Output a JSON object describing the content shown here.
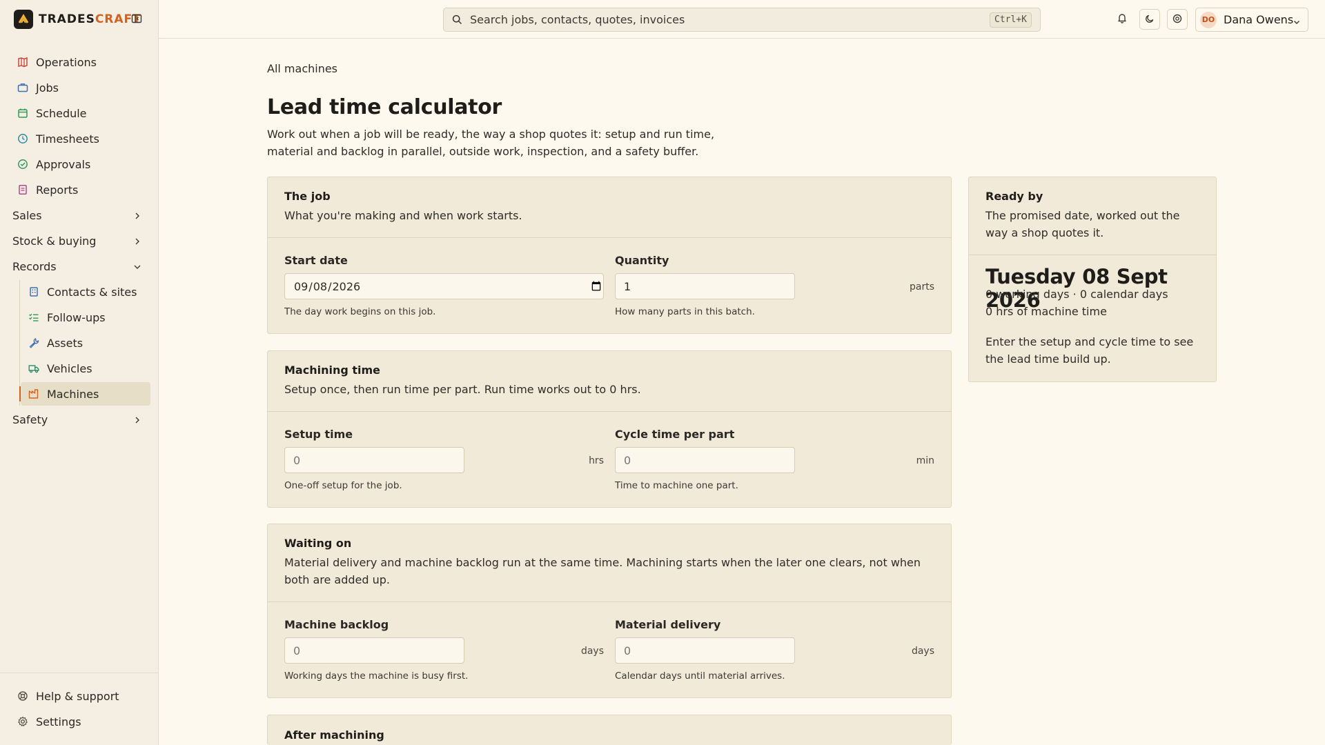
{
  "brand": {
    "name_a": "TRADES",
    "name_b": "CRAFT",
    "accent": "#d2621f"
  },
  "sidebar": {
    "items": [
      {
        "label": "Operations",
        "icon": "map-icon",
        "color": "#c9463d"
      },
      {
        "label": "Jobs",
        "icon": "briefcase-icon",
        "color": "#3f6fb5"
      },
      {
        "label": "Schedule",
        "icon": "calendar-icon",
        "color": "#2f9a56"
      },
      {
        "label": "Timesheets",
        "icon": "clock-icon",
        "color": "#2b8aa6"
      },
      {
        "label": "Approvals",
        "icon": "check-circle-icon",
        "color": "#2f9a56"
      },
      {
        "label": "Reports",
        "icon": "report-icon",
        "color": "#b04a8f"
      }
    ],
    "groups": {
      "sales": "Sales",
      "stock": "Stock & buying",
      "records": "Records",
      "safety": "Safety"
    },
    "records_items": [
      {
        "label": "Contacts & sites",
        "icon": "building-icon",
        "color": "#3f6fb5"
      },
      {
        "label": "Follow-ups",
        "icon": "list-check-icon",
        "color": "#2f9a56"
      },
      {
        "label": "Assets",
        "icon": "wrench-icon",
        "color": "#3f6fb5"
      },
      {
        "label": "Vehicles",
        "icon": "truck-icon",
        "color": "#2f8a6a"
      },
      {
        "label": "Machines",
        "icon": "factory-icon",
        "color": "#d2621f"
      }
    ],
    "footer": {
      "help": "Help & support",
      "settings": "Settings"
    }
  },
  "topbar": {
    "search_placeholder": "Search jobs, contacts, quotes, invoices",
    "shortcut": "Ctrl+K",
    "user_initials": "DO",
    "user_name": "Dana Owens"
  },
  "main": {
    "breadcrumb": "All machines",
    "title": "Lead time calculator",
    "description": "Work out when a job will be ready, the way a shop quotes it: setup and run time, material and backlog in parallel, outside work, inspection, and a safety buffer."
  },
  "job_card": {
    "title": "The job",
    "subtitle": "What you're making and when work starts.",
    "start_date_label": "Start date",
    "start_date_value": "2026-09-08",
    "start_date_hint": "The day work begins on this job.",
    "quantity_label": "Quantity",
    "quantity_value": "1",
    "quantity_unit": "parts",
    "quantity_hint": "How many parts in this batch."
  },
  "machining_card": {
    "title": "Machining time",
    "subtitle": "Setup once, then run time per part. Run time works out to 0 hrs.",
    "setup_label": "Setup time",
    "setup_placeholder": "0",
    "setup_unit": "hrs",
    "setup_hint": "One-off setup for the job.",
    "cycle_label": "Cycle time per part",
    "cycle_placeholder": "0",
    "cycle_unit": "min",
    "cycle_hint": "Time to machine one part."
  },
  "waiting_card": {
    "title": "Waiting on",
    "subtitle": "Material delivery and machine backlog run at the same time. Machining starts when the later one clears, not when both are added up.",
    "backlog_label": "Machine backlog",
    "backlog_placeholder": "0",
    "backlog_unit": "days",
    "backlog_hint": "Working days the machine is busy first.",
    "material_label": "Material delivery",
    "material_placeholder": "0",
    "material_unit": "days",
    "material_hint": "Calendar days until material arrives."
  },
  "after_card": {
    "title": "After machining"
  },
  "ready_card": {
    "title": "Ready by",
    "subtitle": "The promised date, worked out the way a shop quotes it.",
    "date": "Tuesday 08 Sept 2026",
    "days_line": "0 working days · 0 calendar days",
    "hours_line": "0 hrs of machine time",
    "note": "Enter the setup and cycle time to see the lead time build up."
  }
}
